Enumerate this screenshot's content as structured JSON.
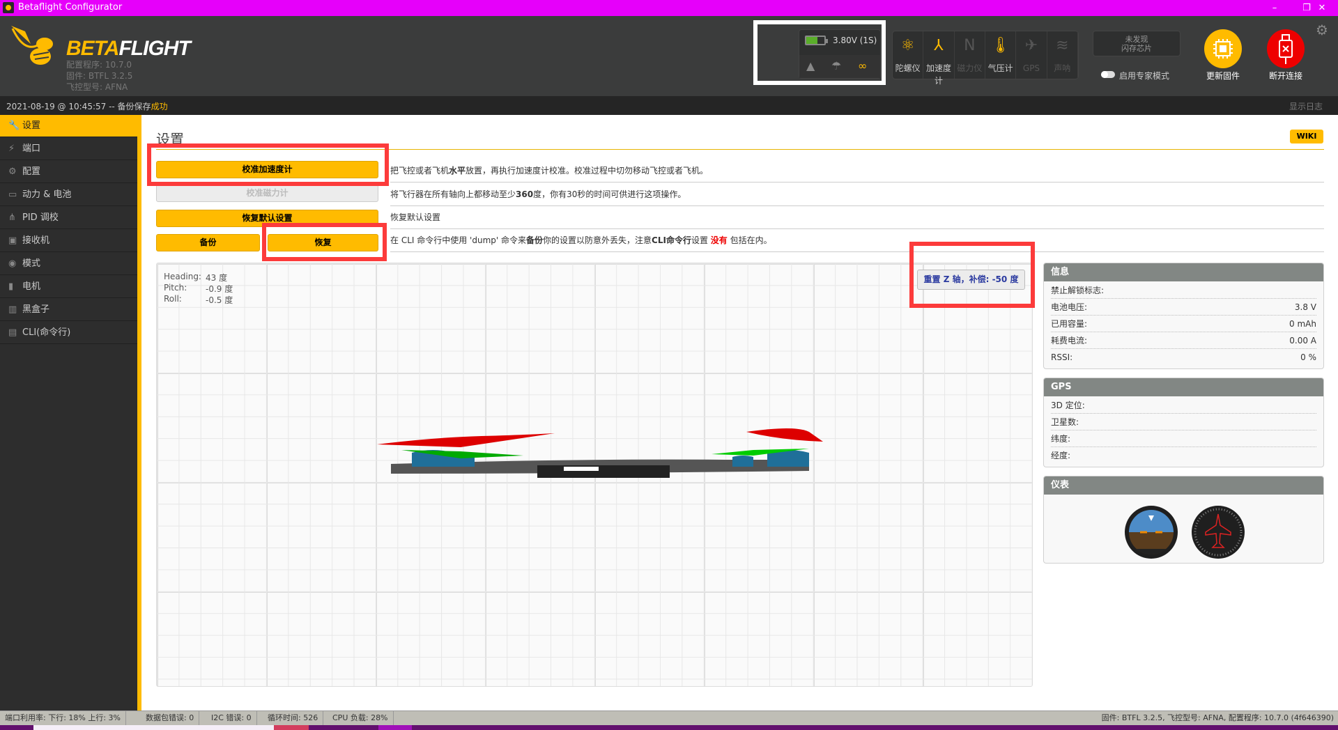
{
  "window": {
    "title": "Betaflight Configurator",
    "controls": {
      "minimize": "–",
      "maximize": "❐",
      "close": "✕"
    }
  },
  "header": {
    "logo_a": "BETA",
    "logo_b": "FLIGHT",
    "configurator_version": "配置程序: 10.7.0",
    "firmware": "固件: BTFL 3.2.5",
    "board": "飞控型号: AFNA",
    "battery": {
      "voltage": "3.80V (1S)",
      "level": 0.6,
      "color": "#5aae2a"
    },
    "sensors": [
      {
        "label": "陀螺仪",
        "icon": "gyro-icon",
        "active": true
      },
      {
        "label": "加速度计",
        "icon": "accelerometer-icon",
        "active": true
      },
      {
        "label": "磁力仪",
        "icon": "magnetometer-icon",
        "active": false
      },
      {
        "label": "气压计",
        "icon": "barometer-icon",
        "active": true
      },
      {
        "label": "GPS",
        "icon": "gps-icon",
        "active": false
      },
      {
        "label": "声呐",
        "icon": "sonar-icon",
        "active": false
      }
    ],
    "flash": "未发现\n闪存芯片",
    "expert_mode": "启用专家模式",
    "update_firmware": "更新固件",
    "disconnect": "断开连接"
  },
  "log": {
    "text": "2021-08-19 @ 10:45:57 -- 备份保存",
    "status": "成功",
    "show_log": "显示日志"
  },
  "sidebar": {
    "items": [
      {
        "label": "设置",
        "icon": "wrench-icon",
        "active": true
      },
      {
        "label": "端口",
        "icon": "plug-icon"
      },
      {
        "label": "配置",
        "icon": "gear-icon"
      },
      {
        "label": "动力 & 电池",
        "icon": "battery-icon"
      },
      {
        "label": "PID 调校",
        "icon": "sitemap-icon"
      },
      {
        "label": "接收机",
        "icon": "receiver-icon"
      },
      {
        "label": "模式",
        "icon": "toggle-icon"
      },
      {
        "label": "电机",
        "icon": "motor-icon"
      },
      {
        "label": "黑盒子",
        "icon": "blackbox-icon"
      },
      {
        "label": "CLI(命令行)",
        "icon": "terminal-icon"
      }
    ]
  },
  "main": {
    "title": "设置",
    "wiki": "WIKI",
    "buttons": {
      "calibrate_acc": "校准加速度计",
      "calibrate_mag": "校准磁力计",
      "reset": "恢复默认设置",
      "backup": "备份",
      "restore": "恢复"
    },
    "descriptions": {
      "acc": [
        "把飞控或者飞机",
        "水平",
        "放置，再执行加速度计校准。校准过程中切勿移动飞控或者飞机。"
      ],
      "mag": [
        "将飞行器在所有轴向上都移动至少",
        "360",
        "度，你有30秒的时间可供进行这项操作。"
      ],
      "reset": [
        "恢复默认设置"
      ],
      "backup": [
        "在 CLI 命令行中使用 'dump' 命令来",
        "备份",
        "你的设置以防意外丢失，注意",
        "CLI命令行",
        "设置 ",
        "没有",
        " 包括在内。"
      ]
    },
    "attitude": {
      "heading_label": "Heading:",
      "heading": "43 度",
      "pitch_label": "Pitch:",
      "pitch": "-0.9 度",
      "roll_label": "Roll:",
      "roll": "-0.5 度"
    },
    "reset_z": "重置 Z 轴，补偿: -50 度"
  },
  "info": {
    "title": "信息",
    "rows": [
      {
        "label": "禁止解锁标志:",
        "value": ""
      },
      {
        "label": "电池电压:",
        "value": "3.8 V"
      },
      {
        "label": "已用容量:",
        "value": "0 mAh"
      },
      {
        "label": "耗费电流:",
        "value": "0.00 A"
      },
      {
        "label": "RSSI:",
        "value": "0 %"
      }
    ]
  },
  "gps": {
    "title": "GPS",
    "rows": [
      {
        "label": "3D 定位:"
      },
      {
        "label": "卫星数:"
      },
      {
        "label": "纬度:"
      },
      {
        "label": "经度:"
      }
    ]
  },
  "instruments": {
    "title": "仪表"
  },
  "status": {
    "port_util": "端口利用率:  下行: 18% 上行: 3%",
    "packet_err": "数据包错误: 0",
    "i2c_err": "I2C 错误: 0",
    "cycle": "循环时间: 526",
    "cpu": "CPU 负载: 28%",
    "version": "固件: BTFL 3.2.5, 飞控型号: AFNA, 配置程序: 10.7.0 (4f646390)"
  }
}
